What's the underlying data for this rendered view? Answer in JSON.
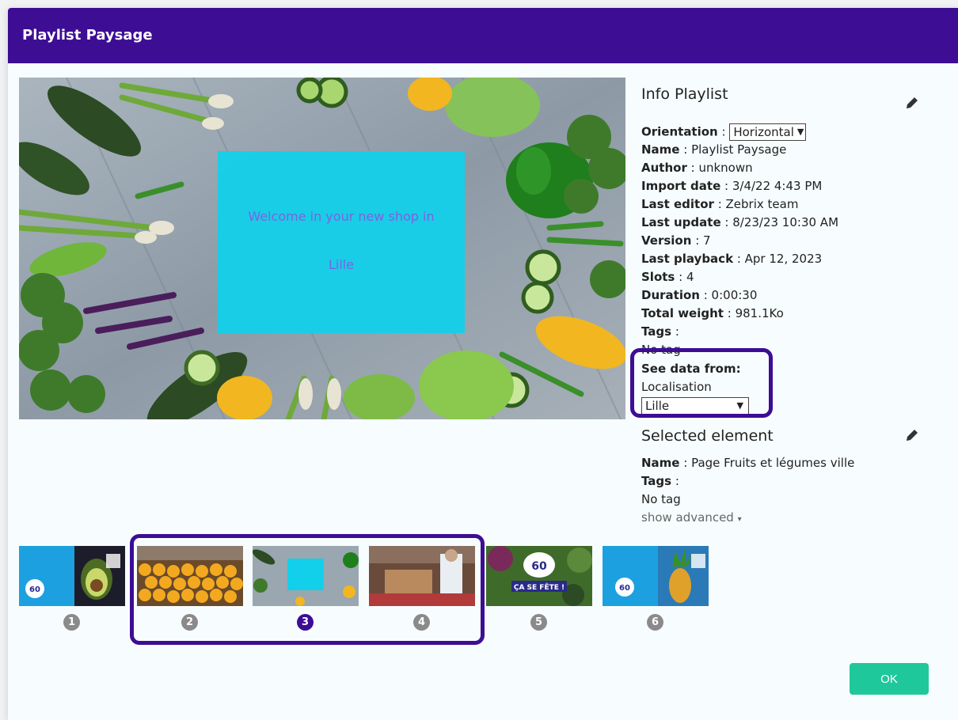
{
  "modal": {
    "title": "Playlist Paysage"
  },
  "preview": {
    "overlay_text": "Welcome in your new shop in",
    "overlay_city": "Lille"
  },
  "info_playlist": {
    "title": "Info Playlist",
    "orientation_label": "Orientation",
    "orientation_value": "Horizontal",
    "fields": [
      {
        "label": "Name",
        "value": "Playlist Paysage"
      },
      {
        "label": "Author",
        "value": "unknown"
      },
      {
        "label": "Import date",
        "value": "3/4/22 4:43 PM"
      },
      {
        "label": "Last editor",
        "value": "Zebrix team"
      },
      {
        "label": "Last update",
        "value": "8/23/23 10:30 AM"
      },
      {
        "label": "Version",
        "value": "7"
      },
      {
        "label": "Last playback",
        "value": "Apr 12, 2023"
      },
      {
        "label": "Slots",
        "value": "4"
      },
      {
        "label": "Duration",
        "value": "0:00:30"
      },
      {
        "label": "Total weight",
        "value": "981.1Ko"
      }
    ],
    "tags_label": "Tags",
    "tags_value": "No tag",
    "see_data_label": "See data from:",
    "localisation_label": "Localisation",
    "localisation_value": "Lille"
  },
  "selected_element": {
    "title": "Selected element",
    "name_label": "Name",
    "name_value": "Page Fruits et légumes ville",
    "tags_label": "Tags",
    "tags_value": "No tag",
    "show_advanced": "show advanced"
  },
  "thumbnails": [
    {
      "number": "1",
      "active": false
    },
    {
      "number": "2",
      "active": false
    },
    {
      "number": "3",
      "active": true
    },
    {
      "number": "4",
      "active": false
    },
    {
      "number": "5",
      "active": false
    },
    {
      "number": "6",
      "active": false
    }
  ],
  "thumb_text": {
    "brand_60": "60",
    "ca_se_fete": "ÇA SE FÊTE !"
  },
  "ok_button": "OK",
  "colors": {
    "header": "#3d0d94",
    "highlight_border": "#3d0d94",
    "ok_button": "#1fc89a",
    "overlay_box": "#13d0ea",
    "overlay_text": "#7e5fe5"
  },
  "icons": [
    "pencil-icon",
    "chevron-down-icon",
    "caret-down-icon"
  ]
}
